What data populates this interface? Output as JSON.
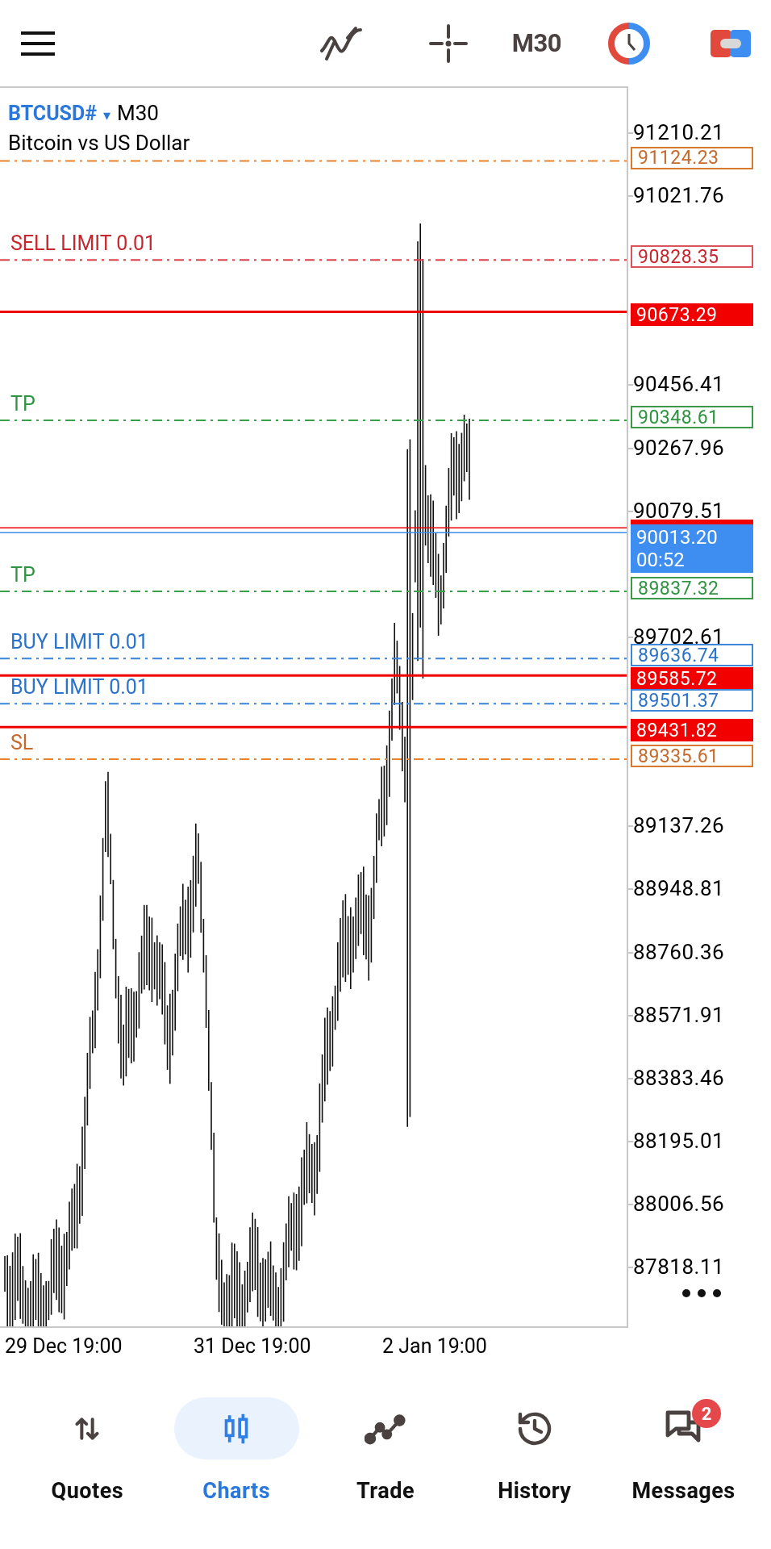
{
  "top_bar": {
    "timeframe": "M30"
  },
  "chart": {
    "symbol": "BTCUSD#",
    "dropdown": "▾",
    "timeframe": "M30",
    "description": "Bitcoin vs US Dollar",
    "price_ticks": [
      "91210.21",
      "91021.76",
      "90456.41",
      "90267.96",
      "90079.51",
      "89702.61",
      "89137.26",
      "88948.81",
      "88760.36",
      "88571.91",
      "88383.46",
      "88195.01",
      "88006.56",
      "87818.11"
    ],
    "order_lines": [
      {
        "kind": "sl",
        "price": "91124.23"
      },
      {
        "kind": "sell_limit",
        "label": "SELL LIMIT 0.01",
        "price": "90828.35"
      },
      {
        "kind": "position",
        "price": "90673.29"
      },
      {
        "kind": "tp",
        "label": "TP",
        "price": "90348.61"
      },
      {
        "kind": "tp",
        "label": "TP",
        "price": "89837.32"
      },
      {
        "kind": "buy_limit",
        "label": "BUY LIMIT 0.01",
        "price": "89636.74"
      },
      {
        "kind": "position",
        "price": "89585.72"
      },
      {
        "kind": "buy_limit",
        "label": "BUY LIMIT 0.01",
        "price": "89501.37"
      },
      {
        "kind": "position",
        "price": "89431.82"
      },
      {
        "kind": "sl",
        "label": "SL",
        "price": "89335.61"
      }
    ],
    "current_price": {
      "price": "90013.20",
      "countdown": "00:52"
    },
    "time_labels": [
      "29 Dec 19:00",
      "31 Dec 19:00",
      "2 Jan 19:00"
    ]
  },
  "nav": [
    {
      "label": "Quotes",
      "selected": false
    },
    {
      "label": "Charts",
      "selected": true
    },
    {
      "label": "Trade",
      "selected": false
    },
    {
      "label": "History",
      "selected": false
    },
    {
      "label": "Messages",
      "selected": false,
      "badge": "2"
    }
  ]
}
